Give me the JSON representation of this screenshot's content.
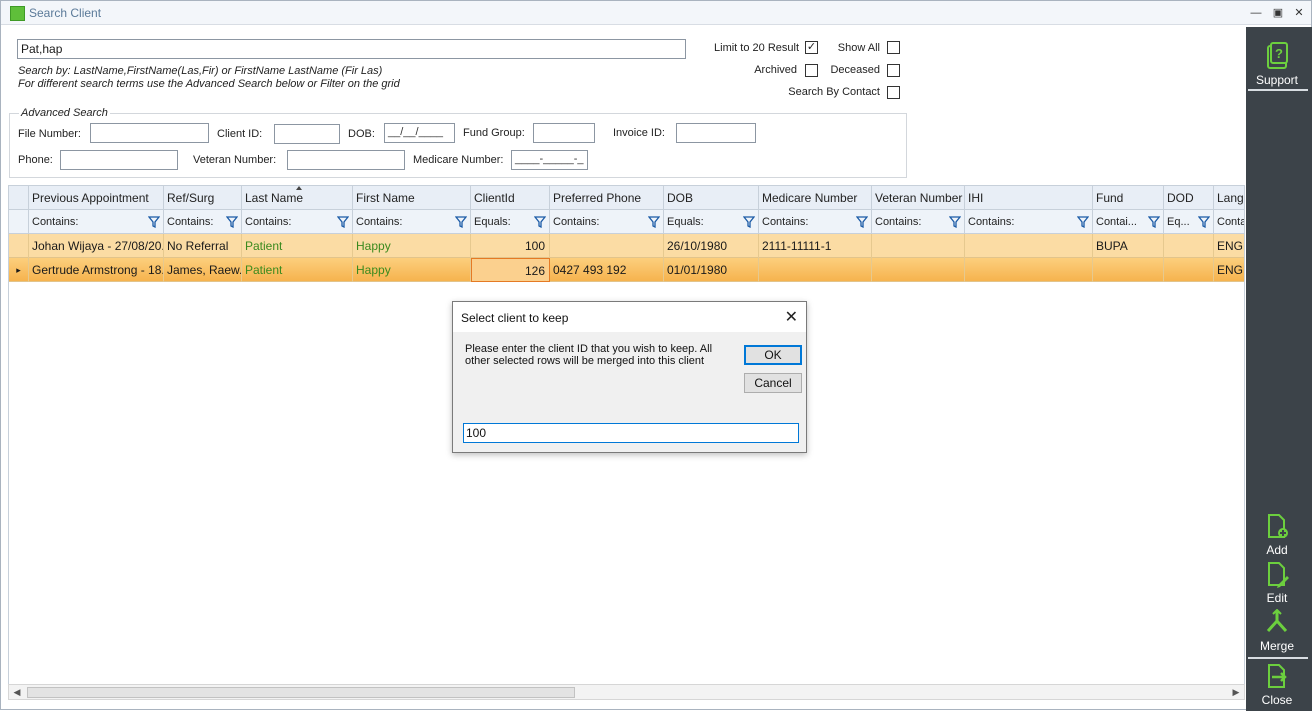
{
  "window": {
    "title": "Search Client",
    "min_icon": "minimize-icon",
    "max_icon": "maximize-icon",
    "close_icon": "close-icon"
  },
  "search": {
    "value": "Pat,hap",
    "hint1": "Search by: LastName,FirstName(Las,Fir) or FirstName LastName (Fir Las)",
    "hint2": "For different search terms use the Advanced Search below or Filter on the grid"
  },
  "options": {
    "limit_label": "Limit to 20 Result",
    "limit_checked": true,
    "show_all_label": "Show All",
    "show_all_checked": false,
    "archived_label": "Archived",
    "archived_checked": false,
    "deceased_label": "Deceased",
    "deceased_checked": false,
    "search_contact_label": "Search By Contact",
    "search_contact_checked": false
  },
  "advanced": {
    "title": "Advanced Search",
    "file_number_label": "File Number:",
    "client_id_label": "Client ID:",
    "dob_label": "DOB:",
    "dob_mask": "__/__/____",
    "fund_group_label": "Fund Group:",
    "invoice_id_label": "Invoice ID:",
    "phone_label": "Phone:",
    "veteran_label": "Veteran Number:",
    "medicare_label": "Medicare Number:",
    "medicare_mask": "____-_____-_"
  },
  "grid": {
    "columns": [
      "Previous Appointment",
      "Ref/Surg",
      "Last Name",
      "First Name",
      "ClientId",
      "Preferred Phone",
      "DOB",
      "Medicare Number",
      "Veteran Number",
      "IHI",
      "Fund",
      "DOD",
      "Langu"
    ],
    "filters": [
      "Contains:",
      "Contains:",
      "Contains:",
      "Contains:",
      "Equals:",
      "Contains:",
      "Equals:",
      "Contains:",
      "Contains:",
      "Contains:",
      "Contai...",
      "Eq...",
      "Conta"
    ],
    "rows": [
      [
        "Johan Wijaya - 27/08/20...",
        "No Referral",
        "Patient",
        "Happy",
        "100",
        "",
        "26/10/1980",
        "2111-11111-1",
        "",
        "",
        "BUPA",
        "",
        "ENGL"
      ],
      [
        "Gertrude Armstrong - 18...",
        "James, Raew...",
        "Patient",
        "Happy",
        "126",
        "0427 493 192",
        "01/01/1980",
        "",
        "",
        "",
        "",
        "",
        "ENGL"
      ]
    ],
    "current_row_indicator": "▸"
  },
  "sidebar": {
    "support": "Support",
    "add": "Add",
    "edit": "Edit",
    "merge": "Merge",
    "close": "Close"
  },
  "dialog": {
    "title": "Select client to keep",
    "message": "Please enter the client ID that you wish to keep. All other selected rows will be merged into this client",
    "ok": "OK",
    "cancel": "Cancel",
    "input_value": "100"
  },
  "colors": {
    "accent_green": "#5fbf3a",
    "sidebar_bg": "#3c4349",
    "row_highlight": "#fbdca4",
    "row_selected": "#f6b34e",
    "focus_blue": "#0078d7"
  }
}
